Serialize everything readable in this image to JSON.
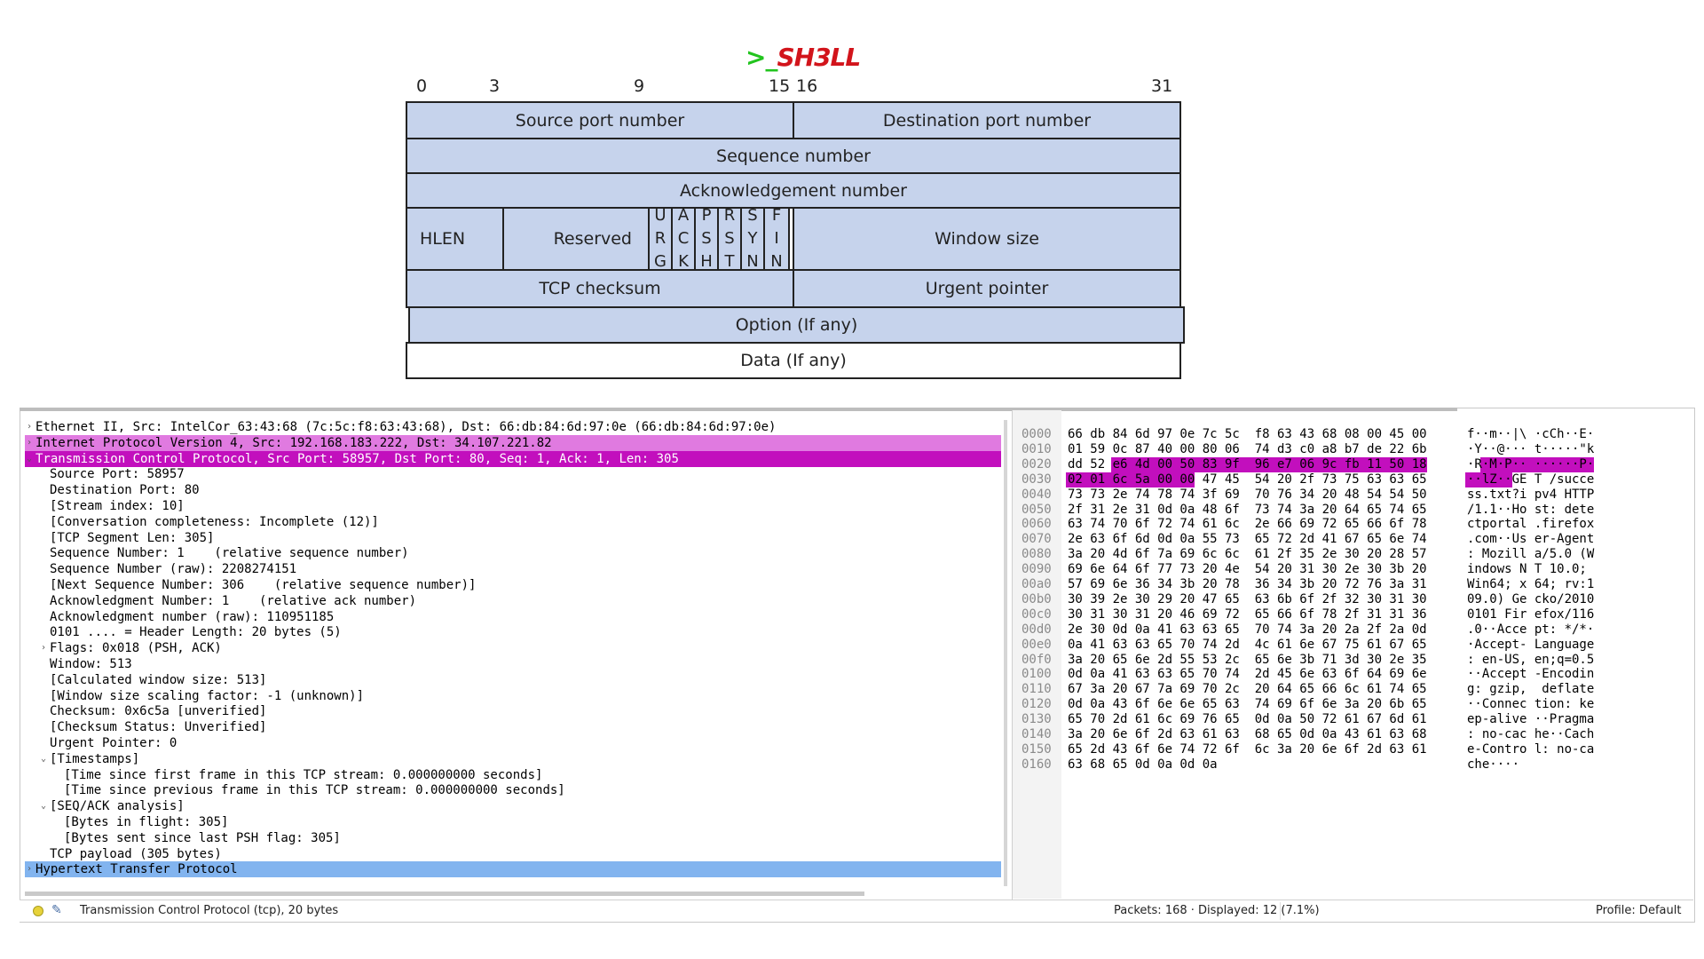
{
  "logo": {
    "prompt": ">_",
    "name": "SH3LL"
  },
  "diagram": {
    "bit_labels": [
      "0",
      "3",
      "9",
      "15",
      "16",
      "31"
    ],
    "source_port": "Source port number",
    "dest_port": "Destination port number",
    "sequence": "Sequence number",
    "ack": "Acknowledgement number",
    "hlen": "HLEN",
    "reserved": "Reserved",
    "flags": [
      [
        "U",
        "R",
        "G"
      ],
      [
        "A",
        "C",
        "K"
      ],
      [
        "P",
        "S",
        "H"
      ],
      [
        "R",
        "S",
        "T"
      ],
      [
        "S",
        "Y",
        "N"
      ],
      [
        "F",
        "I",
        "N"
      ]
    ],
    "window": "Window size",
    "checksum": "TCP checksum",
    "urgent": "Urgent pointer",
    "option": "Option  (If any)",
    "data": "Data (If any)"
  },
  "tree": [
    "Ethernet II, Src: IntelCor_63:43:68 (7c:5c:f8:63:43:68), Dst: 66:db:84:6d:97:0e (66:db:84:6d:97:0e)",
    "Internet Protocol Version 4, Src: 192.168.183.222, Dst: 34.107.221.82",
    "Transmission Control Protocol, Src Port: 58957, Dst Port: 80, Seq: 1, Ack: 1, Len: 305",
    "Source Port: 58957",
    "Destination Port: 80",
    "[Stream index: 10]",
    "[Conversation completeness: Incomplete (12)]",
    "[TCP Segment Len: 305]",
    "Sequence Number: 1    (relative sequence number)",
    "Sequence Number (raw): 2208274151",
    "[Next Sequence Number: 306    (relative sequence number)]",
    "Acknowledgment Number: 1    (relative ack number)",
    "Acknowledgment number (raw): 110951185",
    "0101 .... = Header Length: 20 bytes (5)",
    "Flags: 0x018 (PSH, ACK)",
    "Window: 513",
    "[Calculated window size: 513]",
    "[Window size scaling factor: -1 (unknown)]",
    "Checksum: 0x6c5a [unverified]",
    "[Checksum Status: Unverified]",
    "Urgent Pointer: 0",
    "[Timestamps]",
    "[Time since first frame in this TCP stream: 0.000000000 seconds]",
    "[Time since previous frame in this TCP stream: 0.000000000 seconds]",
    "[SEQ/ACK analysis]",
    "[Bytes in flight: 305]",
    "[Bytes sent since last PSH flag: 305]",
    "TCP payload (305 bytes)",
    "Hypertext Transfer Protocol"
  ],
  "twisty": {
    "collapsed": "›",
    "expanded": "⌄"
  },
  "bytes": [
    [
      "0000",
      "66 db 84 6d 97 0e 7c 5c  f8 63 43 68 08 00 45 00",
      "f··m··|\\ ·cCh··E·"
    ],
    [
      "0010",
      "01 59 0c 87 40 00 80 06  74 d3 c0 a8 b7 de 22 6b",
      "·Y··@··· t·····\"k"
    ],
    [
      "0020",
      "dd 52 e6 4d 00 50 83 9f  96 e7 06 9c fb 11 50 18",
      "·R·M·P·· ······P·"
    ],
    [
      "0030",
      "02 01 6c 5a 00 00 47 45  54 20 2f 73 75 63 63 65",
      "··lZ··GE T /succe"
    ],
    [
      "0040",
      "73 73 2e 74 78 74 3f 69  70 76 34 20 48 54 54 50",
      "ss.txt?i pv4 HTTP"
    ],
    [
      "0050",
      "2f 31 2e 31 0d 0a 48 6f  73 74 3a 20 64 65 74 65",
      "/1.1··Ho st: dete"
    ],
    [
      "0060",
      "63 74 70 6f 72 74 61 6c  2e 66 69 72 65 66 6f 78",
      "ctportal .firefox"
    ],
    [
      "0070",
      "2e 63 6f 6d 0d 0a 55 73  65 72 2d 41 67 65 6e 74",
      ".com··Us er-Agent"
    ],
    [
      "0080",
      "3a 20 4d 6f 7a 69 6c 6c  61 2f 35 2e 30 20 28 57",
      ": Mozill a/5.0 (W"
    ],
    [
      "0090",
      "69 6e 64 6f 77 73 20 4e  54 20 31 30 2e 30 3b 20",
      "indows N T 10.0; "
    ],
    [
      "00a0",
      "57 69 6e 36 34 3b 20 78  36 34 3b 20 72 76 3a 31",
      "Win64; x 64; rv:1"
    ],
    [
      "00b0",
      "30 39 2e 30 29 20 47 65  63 6b 6f 2f 32 30 31 30",
      "09.0) Ge cko/2010"
    ],
    [
      "00c0",
      "30 31 30 31 20 46 69 72  65 66 6f 78 2f 31 31 36",
      "0101 Fir efox/116"
    ],
    [
      "00d0",
      "2e 30 0d 0a 41 63 63 65  70 74 3a 20 2a 2f 2a 0d",
      ".0··Acce pt: */*·"
    ],
    [
      "00e0",
      "0a 41 63 63 65 70 74 2d  4c 61 6e 67 75 61 67 65",
      "·Accept- Language"
    ],
    [
      "00f0",
      "3a 20 65 6e 2d 55 53 2c  65 6e 3b 71 3d 30 2e 35",
      ": en-US, en;q=0.5"
    ],
    [
      "0100",
      "0d 0a 41 63 63 65 70 74  2d 45 6e 63 6f 64 69 6e",
      "··Accept -Encodin"
    ],
    [
      "0110",
      "67 3a 20 67 7a 69 70 2c  20 64 65 66 6c 61 74 65",
      "g: gzip,  deflate"
    ],
    [
      "0120",
      "0d 0a 43 6f 6e 6e 65 63  74 69 6f 6e 3a 20 6b 65",
      "··Connec tion: ke"
    ],
    [
      "0130",
      "65 70 2d 61 6c 69 76 65  0d 0a 50 72 61 67 6d 61",
      "ep-alive ··Pragma"
    ],
    [
      "0140",
      "3a 20 6e 6f 2d 63 61 63  68 65 0d 0a 43 61 63 68",
      ": no-cac he··Cach"
    ],
    [
      "0150",
      "65 2d 43 6f 6e 74 72 6f  6c 3a 20 6e 6f 2d 63 61",
      "e-Contro l: no-ca"
    ],
    [
      "0160",
      "63 68 65 0d 0a 0d 0a",
      "che····"
    ]
  ],
  "status": {
    "message": "Transmission Control Protocol (tcp), 20 bytes",
    "packets": "Packets: 168 · Displayed: 12 (7.1%)",
    "profile": "Profile: Default"
  },
  "colors": {
    "selected": "#c20fbd",
    "ip_row": "#e07ae0",
    "http_row": "#82b4ef",
    "diagram_fill": "#c6d3ec"
  }
}
